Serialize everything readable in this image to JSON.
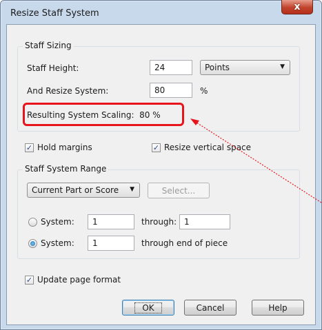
{
  "window": {
    "title": "Resize Staff System",
    "close_glyph": "x"
  },
  "staff_sizing": {
    "group_label": "Staff Sizing",
    "height_label": "Staff Height:",
    "height_value": "24",
    "units_value": "Points",
    "resize_label": "And Resize System:",
    "resize_value": "80",
    "percent_unit": "%",
    "result_text": "Resulting System Scaling:  80 %"
  },
  "options": {
    "hold_margins": "Hold margins",
    "hold_margins_checked": true,
    "resize_vertical": "Resize vertical space",
    "resize_vertical_checked": true
  },
  "range": {
    "group_label": "Staff System Range",
    "scope_value": "Current Part or Score",
    "select_button": "Select...",
    "system1_label": "System:",
    "system1_value": "1",
    "through_label": "through:",
    "through_value": "1",
    "system2_label": "System:",
    "system2_value": "1",
    "through_end_label": "through end of piece",
    "selected_radio": "system2"
  },
  "footer": {
    "update_page_format": "Update page format",
    "update_checked": true,
    "ok": "OK",
    "cancel": "Cancel",
    "help": "Help"
  },
  "annotation": {
    "color": "#e8141c"
  }
}
